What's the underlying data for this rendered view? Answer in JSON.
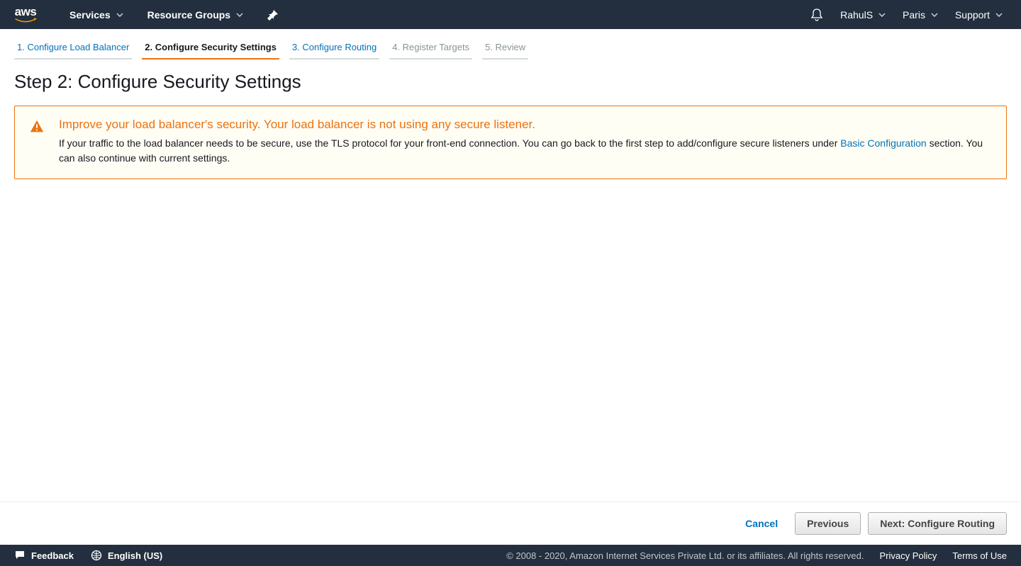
{
  "header": {
    "logo_text": "aws",
    "services_label": "Services",
    "resource_groups_label": "Resource Groups",
    "user": "RahulS",
    "region": "Paris",
    "support_label": "Support"
  },
  "wizard": {
    "tabs": [
      {
        "label": "1. Configure Load Balancer",
        "state": "link"
      },
      {
        "label": "2. Configure Security Settings",
        "state": "active"
      },
      {
        "label": "3. Configure Routing",
        "state": "link"
      },
      {
        "label": "4. Register Targets",
        "state": "disabled"
      },
      {
        "label": "5. Review",
        "state": "disabled"
      }
    ]
  },
  "page": {
    "title": "Step 2: Configure Security Settings"
  },
  "alert": {
    "heading": "Improve your load balancer's security. Your load balancer is not using any secure listener.",
    "text_part1": "If your traffic to the load balancer needs to be secure, use the TLS protocol for your front-end connection. You can go back to the first step to add/configure secure listeners under ",
    "link_label": "Basic Configuration",
    "text_part2": " section. You can also continue with current settings."
  },
  "toolbar": {
    "cancel_label": "Cancel",
    "previous_label": "Previous",
    "next_label": "Next: Configure Routing"
  },
  "footer": {
    "feedback_label": "Feedback",
    "language_label": "English (US)",
    "copyright": "© 2008 - 2020, Amazon Internet Services Private Ltd. or its affiliates. All rights reserved.",
    "privacy_label": "Privacy Policy",
    "terms_label": "Terms of Use"
  }
}
